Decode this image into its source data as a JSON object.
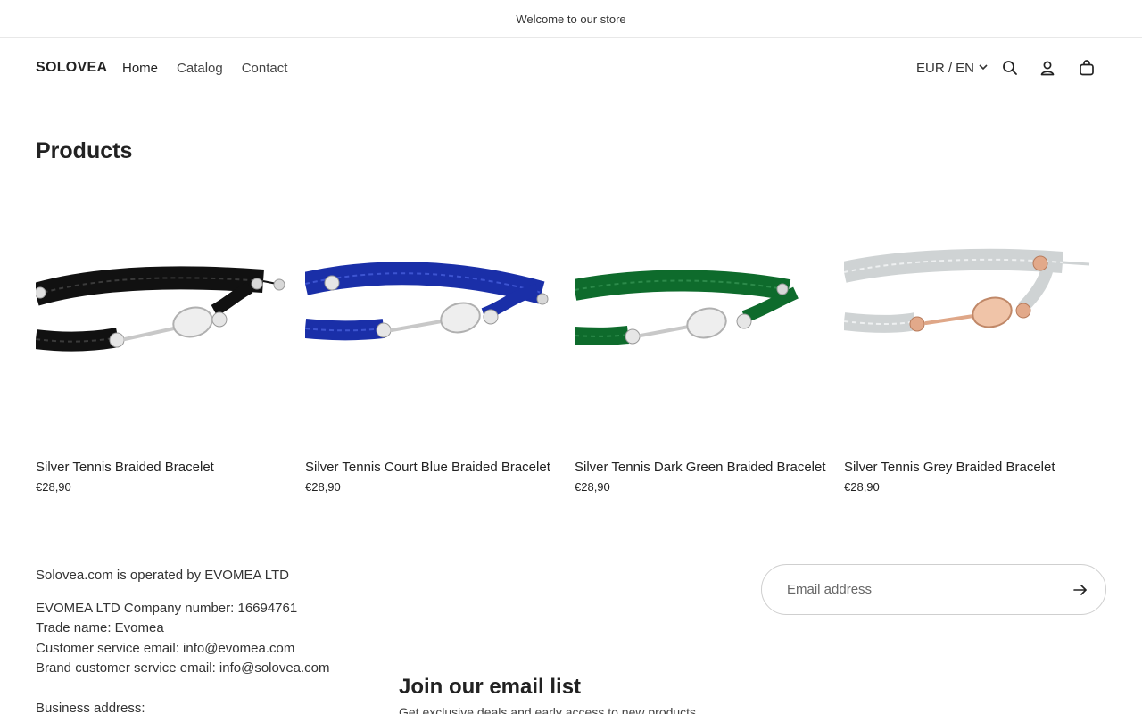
{
  "announcement": "Welcome to our store",
  "header": {
    "logo": "SOLOVEA",
    "nav": [
      {
        "label": "Home"
      },
      {
        "label": "Catalog"
      },
      {
        "label": "Contact"
      }
    ],
    "locale": "EUR / EN",
    "icons": [
      "search-icon",
      "account-icon",
      "cart-icon",
      "chevron-down-icon"
    ]
  },
  "page": {
    "title": "Products"
  },
  "products": [
    {
      "name": "Silver Tennis Braided Bracelet",
      "price": "€28,90",
      "color": "#111111"
    },
    {
      "name": "Silver Tennis Court Blue Braided Bracelet",
      "price": "€28,90",
      "color": "#1a2fa8"
    },
    {
      "name": "Silver Tennis Dark Green Braided Bracelet",
      "price": "€28,90",
      "color": "#0e6b2c"
    },
    {
      "name": "Silver Tennis Grey Braided Bracelet",
      "price": "€28,90",
      "color": "#cfd3d4"
    }
  ],
  "footer": {
    "operated": "Solovea.com is operated by EVOMEA LTD",
    "company": "EVOMEA LTD Company number: 16694761",
    "trade": "Trade name: Evomea",
    "cs_email": "Customer service email: info@evomea.com",
    "brand_email": "Brand customer service email: info@solovea.com",
    "address_label": "Business address:",
    "newsletter": {
      "placeholder": "Email address",
      "title": "Join our email list",
      "subtitle": "Get exclusive deals and early access to new products."
    }
  }
}
